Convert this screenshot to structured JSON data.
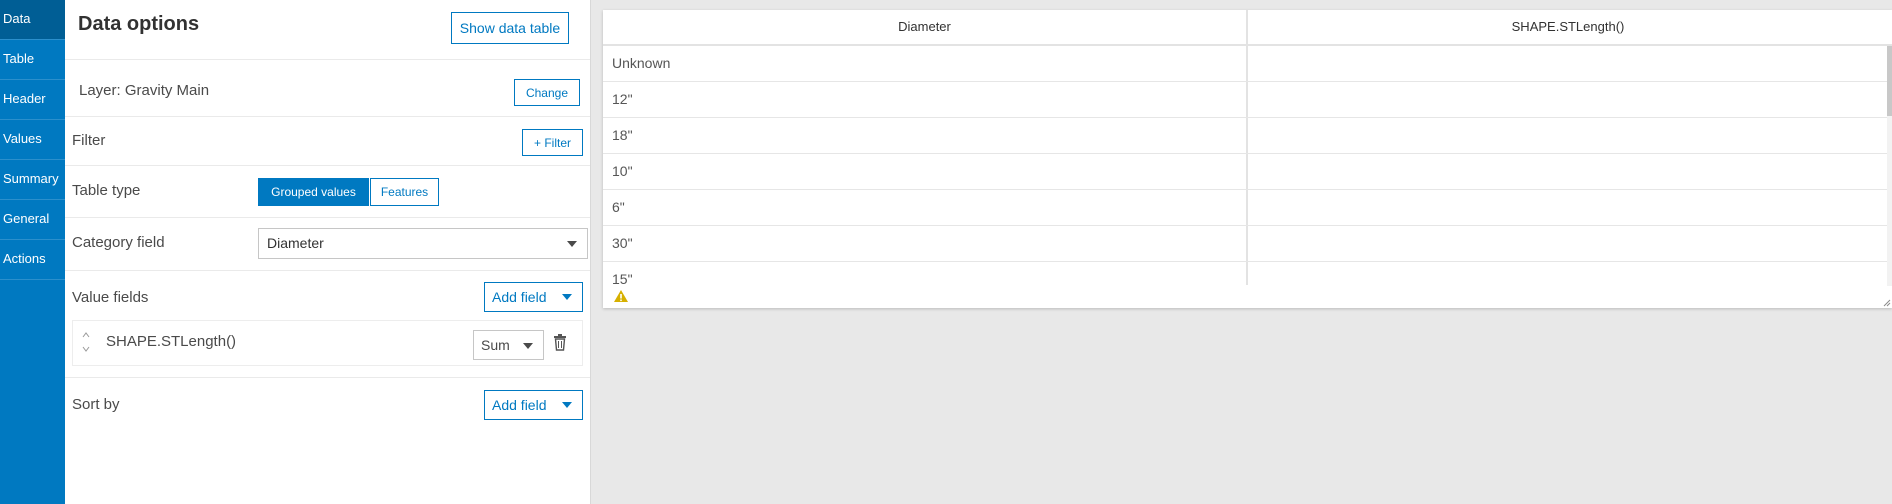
{
  "sidenav": {
    "items": [
      {
        "label": "Data"
      },
      {
        "label": "Table"
      },
      {
        "label": "Header"
      },
      {
        "label": "Values"
      },
      {
        "label": "Summary"
      },
      {
        "label": "General"
      },
      {
        "label": "Actions"
      }
    ]
  },
  "panel": {
    "title": "Data options",
    "show_data_table_label": "Show data table",
    "layer_label": "Layer: Gravity Main",
    "change_label": "Change",
    "filter_label": "Filter",
    "add_filter_label": "+ Filter",
    "table_type_label": "Table type",
    "table_type_options": [
      "Grouped values",
      "Features"
    ],
    "table_type_selected": "Grouped values",
    "category_field_label": "Category field",
    "category_field_value": "Diameter",
    "value_fields_label": "Value fields",
    "add_field_label": "Add field",
    "value_field": {
      "name": "SHAPE.STLength()",
      "statistic": "Sum"
    },
    "sort_by_label": "Sort by",
    "sort_add_field_label": "Add field"
  },
  "table": {
    "columns": [
      "Diameter",
      "SHAPE.STLength()"
    ],
    "rows": [
      [
        "Unknown",
        ""
      ],
      [
        "12\"",
        ""
      ],
      [
        "18\"",
        ""
      ],
      [
        "10\"",
        ""
      ],
      [
        "6\"",
        ""
      ],
      [
        "30\"",
        ""
      ],
      [
        "15\"",
        ""
      ]
    ]
  },
  "icons": {
    "warning": "warning-icon",
    "trash": "trash-icon",
    "drag": "drag-handle-icon",
    "resize": "resize-handle-icon"
  },
  "colors": {
    "accent": "#0079c1",
    "accent_dark": "#005e95",
    "warning": "#d6b000"
  }
}
